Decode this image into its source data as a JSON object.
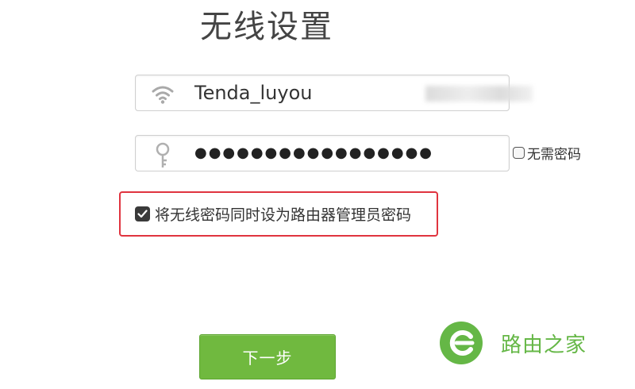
{
  "page": {
    "title": "无线设置"
  },
  "ssid_field": {
    "value": "Tenda_luyou",
    "icon": "wifi-icon"
  },
  "password_field": {
    "value": "●●●●●●●●●●●●●●●●●",
    "icon": "key-icon"
  },
  "no_password": {
    "label": "无需密码",
    "checked": false
  },
  "admin_password_option": {
    "label": "将无线密码同时设为路由器管理员密码",
    "checked": true
  },
  "next_button": {
    "label": "下一步"
  },
  "watermark": {
    "text": "路由之家"
  },
  "colors": {
    "button": "#70b93f",
    "highlight_border": "#e0343f",
    "watermark": "#65b746"
  }
}
